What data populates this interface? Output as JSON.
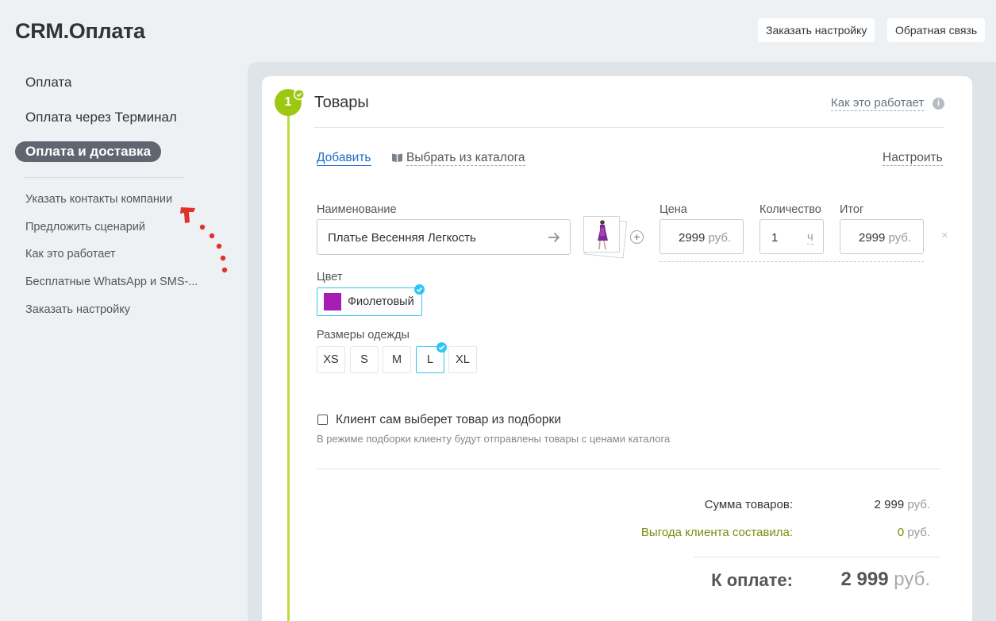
{
  "app": {
    "title": "CRM.Оплата"
  },
  "header": {
    "order_setup": "Заказать настройку",
    "feedback": "Обратная связь"
  },
  "sidebar": {
    "main_items": [
      {
        "label": "Оплата",
        "active": false
      },
      {
        "label": "Оплата через Терминал",
        "active": false
      },
      {
        "label": "Оплата и доставка",
        "active": true
      }
    ],
    "sub_items": [
      {
        "label": "Указать контакты компании"
      },
      {
        "label": "Предложить сценарий"
      },
      {
        "label": "Как это работает"
      },
      {
        "label": "Бесплатные WhatsApp и SMS-..."
      },
      {
        "label": "Заказать настройку"
      }
    ]
  },
  "step": {
    "number": "1",
    "title": "Товары",
    "how_it_works": "Как это работает",
    "info_glyph": "i",
    "accent_color": "#9cc812"
  },
  "toolbar": {
    "add": "Добавить",
    "catalog": "Выбрать из каталога",
    "configure": "Настроить"
  },
  "product": {
    "name_label": "Наименование",
    "name_value": "Платье Весенняя Легкость",
    "price_label": "Цена",
    "price_value": "2999",
    "price_unit": "руб.",
    "qty_label": "Количество",
    "qty_value": "1",
    "qty_unit": "ч",
    "total_label": "Итог",
    "total_value": "2999",
    "total_unit": "руб.",
    "color_label": "Цвет",
    "color_value": "Фиолетовый",
    "color_swatch": "#a51eb4",
    "size_label": "Размеры одежды",
    "sizes": [
      "XS",
      "S",
      "M",
      "L",
      "XL"
    ],
    "selected_size": "L",
    "remove_glyph": "×",
    "add_glyph": "+"
  },
  "selection": {
    "checkbox_label": "Клиент сам выберет товар из подборки",
    "hint": "В режиме подборки клиенту будут отправлены товары с ценами каталога",
    "checked": false
  },
  "summary": {
    "sum_label": "Сумма товаров:",
    "sum_value": "2 999",
    "sum_unit": "руб.",
    "benefit_label": "Выгода клиента составила:",
    "benefit_value": "0",
    "benefit_unit": "руб.",
    "total_label": "К оплате:",
    "total_value": "2 999",
    "total_unit": "руб."
  }
}
